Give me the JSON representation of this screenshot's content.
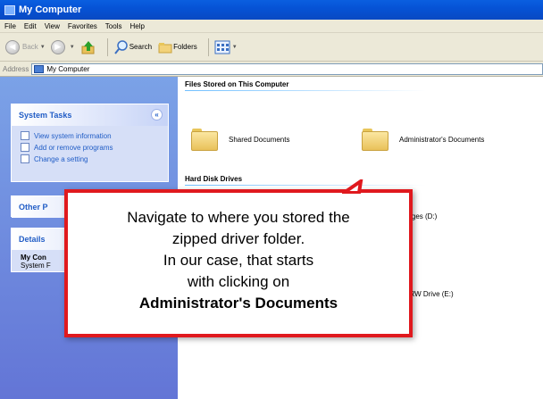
{
  "window": {
    "title": "My Computer"
  },
  "menu": [
    "File",
    "Edit",
    "View",
    "Favorites",
    "Tools",
    "Help"
  ],
  "toolbar": {
    "back": "Back",
    "search": "Search",
    "folders": "Folders"
  },
  "address": {
    "label": "Address",
    "value": "My Computer"
  },
  "system_tasks": {
    "title": "System Tasks",
    "items": [
      "View system information",
      "Add or remove programs",
      "Change a setting"
    ]
  },
  "other_places": {
    "title": "Other P"
  },
  "details": {
    "title": "Details",
    "name": "My Con",
    "type": "System F"
  },
  "main": {
    "files_header": "Files Stored on This Computer",
    "folders": [
      "Shared Documents",
      "Administrator's Documents"
    ],
    "drives_header": "Hard Disk Drives",
    "drive_d": "nages (D:)",
    "drive_e": "D-RW Drive (E:)"
  },
  "callout": {
    "lines": [
      "Navigate to where you stored the",
      "zipped driver folder.",
      "In our case, that starts",
      "with clicking on"
    ],
    "emphasis": "Administrator's Documents"
  },
  "colors": {
    "callout_border": "#e0191e",
    "title_bar": "#0653d6",
    "sidebar": "#6d8de0"
  }
}
